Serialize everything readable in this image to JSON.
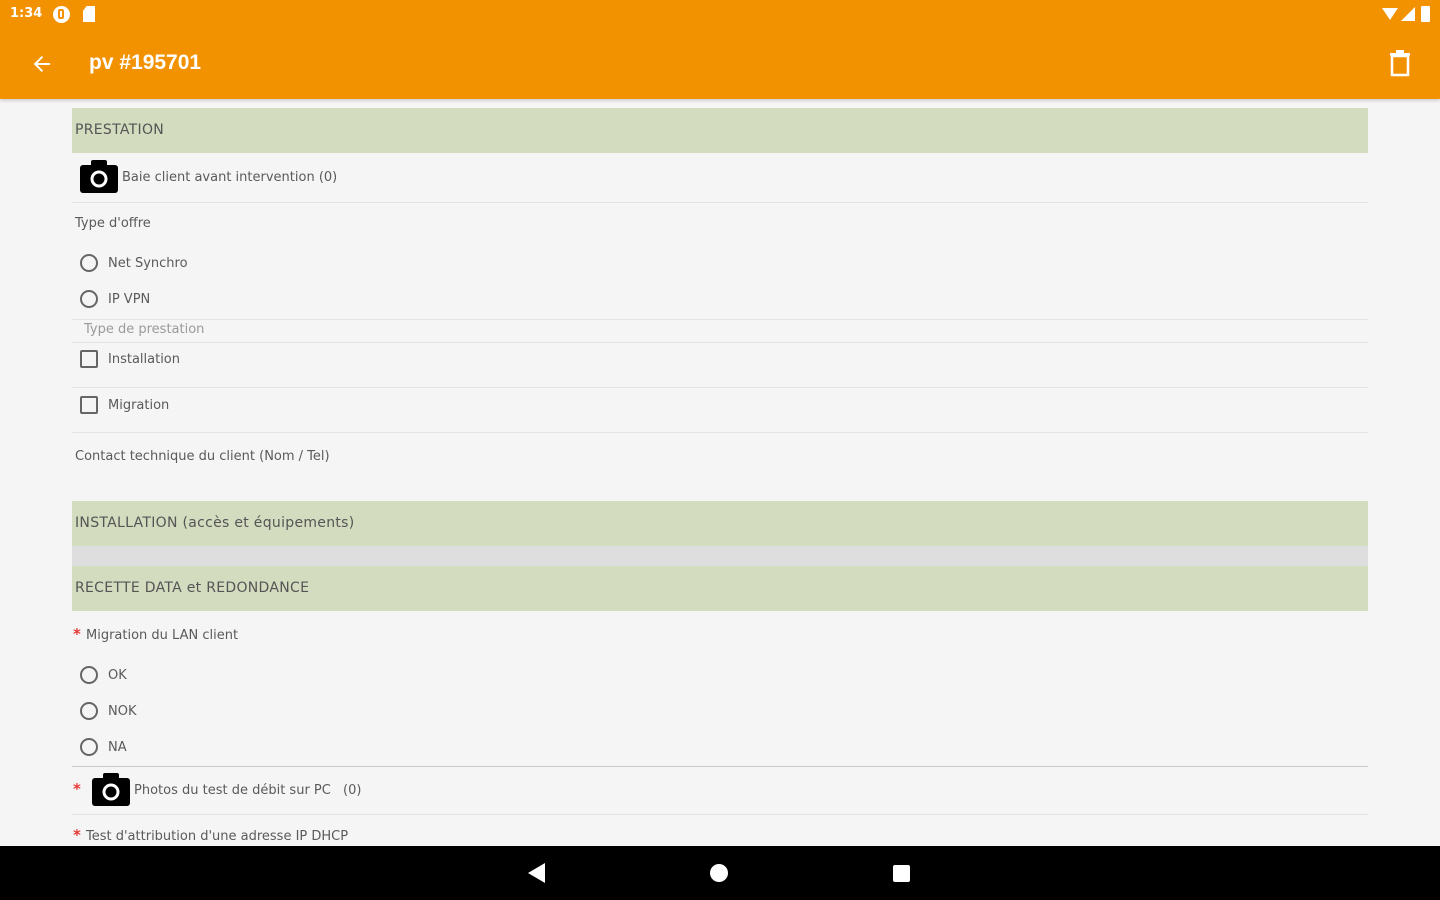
{
  "status_bar": {
    "time": "1:34",
    "icons": [
      "settings-icon",
      "sd-card-icon",
      "wifi-icon",
      "signal-icon",
      "battery-icon"
    ]
  },
  "app_bar": {
    "title": "pv #195701",
    "back_icon": "arrow-back-icon",
    "delete_icon": "trash-icon"
  },
  "sections": {
    "prestation": {
      "header": "PRESTATION",
      "photo_label": "Baie client avant intervention (0)",
      "type_offre_label": "Type d'offre",
      "type_offre_options": [
        "Net Synchro",
        "IP VPN"
      ],
      "type_prestation_hint": "Type de prestation",
      "type_prestation_options": [
        "Installation",
        "Migration"
      ],
      "contact_label": "Contact technique du client (Nom / Tel)"
    },
    "installation": {
      "header": "INSTALLATION (accès et équipements)"
    },
    "recette": {
      "header": "RECETTE DATA et REDONDANCE",
      "migration_lan_label": "Migration du LAN client",
      "migration_lan_options": [
        "OK",
        "NOK",
        "NA"
      ],
      "photos_debit_label": "Photos du test de débit sur PC",
      "photos_debit_count": "(0)",
      "dhcp_label": "Test d'attribution d'une adresse IP DHCP",
      "required_mark": "*"
    }
  },
  "nav_bar": {
    "icons": [
      "nav-back-icon",
      "nav-home-icon",
      "nav-recents-icon"
    ]
  },
  "colors": {
    "accent": "#f39200",
    "section_header_bg": "#d3dcbf",
    "required": "#e53935",
    "background": "#f5f5f5"
  }
}
